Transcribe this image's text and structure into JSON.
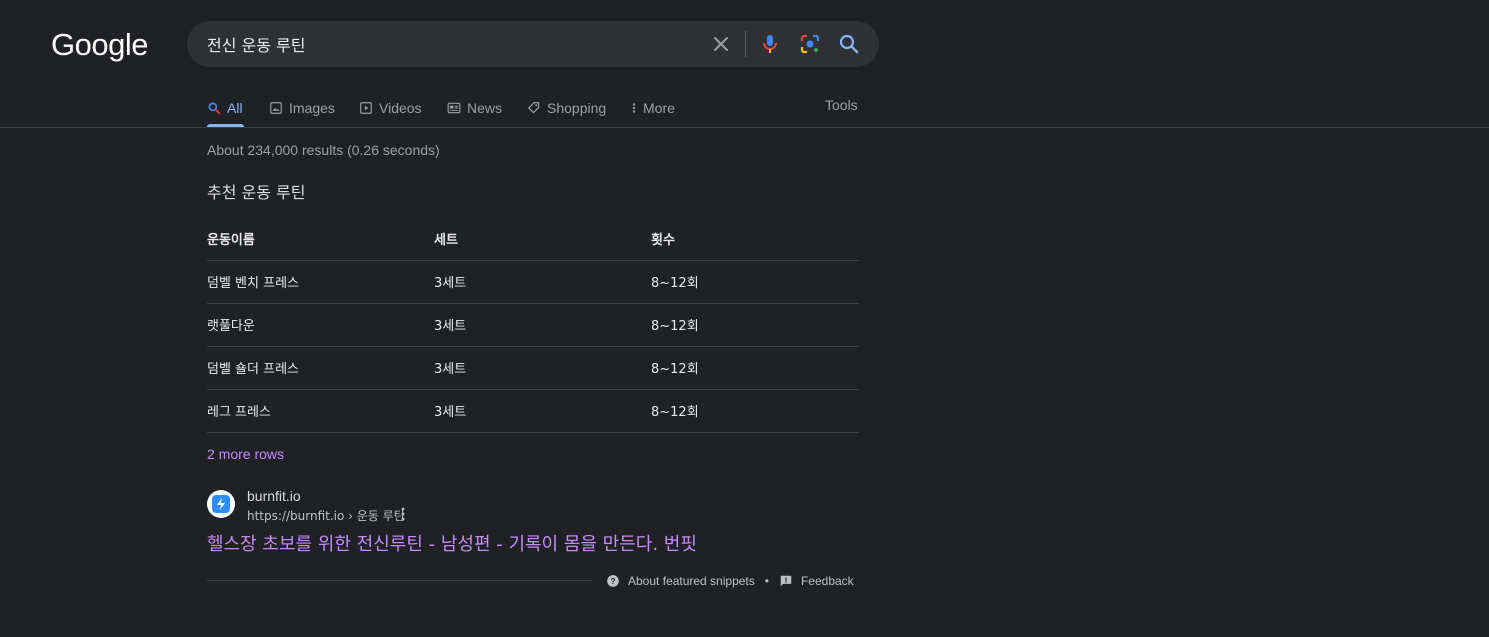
{
  "logo": "Google",
  "search": {
    "query": "전신 운동 루틴"
  },
  "tabs": [
    {
      "label": "All"
    },
    {
      "label": "Images"
    },
    {
      "label": "Videos"
    },
    {
      "label": "News"
    },
    {
      "label": "Shopping"
    },
    {
      "label": "More"
    }
  ],
  "tools_label": "Tools",
  "results_stats": "About 234,000 results (0.26 seconds)",
  "snippet": {
    "heading": "추천 운동 루틴",
    "columns": [
      "운동이름",
      "세트",
      "횟수"
    ],
    "rows": [
      [
        "덤벨 벤치 프레스",
        "3세트",
        "8~12회"
      ],
      [
        "랫풀다운",
        "3세트",
        "8~12회"
      ],
      [
        "덤벨 숄더 프레스",
        "3세트",
        "8~12회"
      ],
      [
        "레그 프레스",
        "3세트",
        "8~12회"
      ]
    ],
    "more_rows": "2 more rows"
  },
  "result": {
    "site_name": "burnfit.io",
    "url": "https://burnfit.io › 운동 루틴",
    "title": "헬스장 초보를 위한 전신루틴 - 남성편 - 기록이 몸을 만든다. 번핏"
  },
  "footer": {
    "about_snippets": "About featured snippets",
    "separator": "•",
    "feedback": "Feedback"
  },
  "colors": {
    "background": "#202124",
    "link_visited": "#c58af9",
    "tab_active": "#8ab4f8"
  }
}
